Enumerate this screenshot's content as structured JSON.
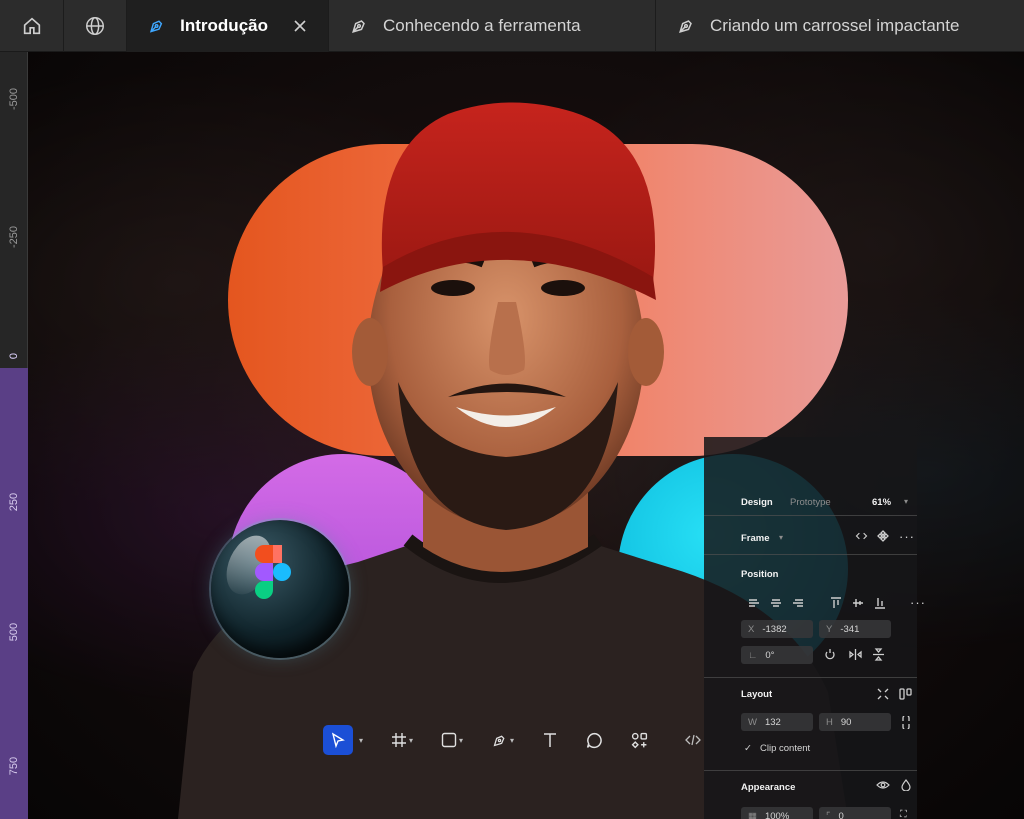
{
  "tabs": [
    {
      "label": "Introdução",
      "active": true
    },
    {
      "label": "Conhecendo a ferramenta",
      "active": false
    },
    {
      "label": "Criando um carrossel impactante",
      "active": false
    }
  ],
  "ruler": {
    "labels": [
      "-500",
      "-250",
      "0",
      "250",
      "500",
      "750"
    ]
  },
  "toolbar": {
    "tools": [
      "move-tool",
      "frame-tool",
      "shape-tool",
      "pen-tool",
      "text-tool",
      "comment-tool",
      "actions-tool",
      "dev-mode-tool"
    ]
  },
  "panel": {
    "tab_design": "Design",
    "tab_prototype": "Prototype",
    "zoom": "61%",
    "frame_label": "Frame",
    "position_label": "Position",
    "x_key": "X",
    "x_value": "-1382",
    "y_key": "Y",
    "y_value": "-341",
    "rotation_value": "0°",
    "layout_label": "Layout",
    "w_key": "W",
    "w_value": "132",
    "h_key": "H",
    "h_value": "90",
    "clip_content_label": "Clip content",
    "appearance_label": "Appearance",
    "opacity_value": "100%",
    "radius_value": "0"
  },
  "colors": {
    "accent": "#1b4fd6",
    "ruler_selection": "#5a3f86",
    "figma_orange": "#e4561f",
    "figma_purple": "#a547d6",
    "figma_blue": "#0fbedf"
  }
}
